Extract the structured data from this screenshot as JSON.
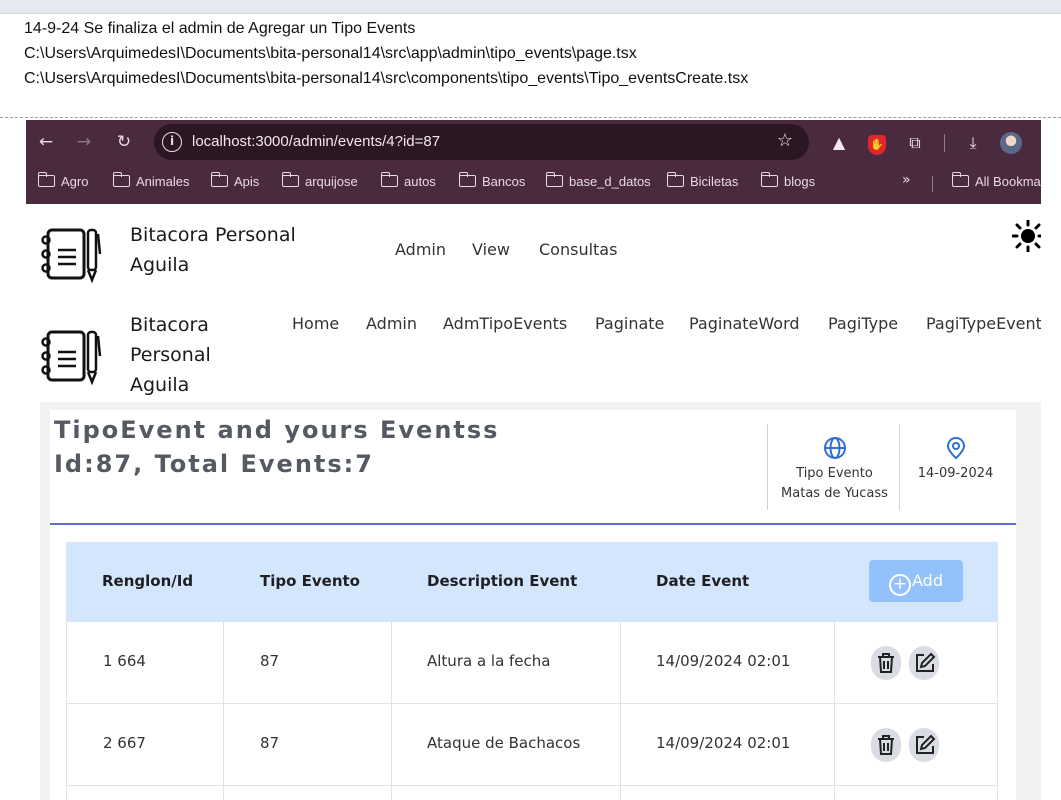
{
  "notes": {
    "line1": "14-9-24  Se finaliza el admin de Agregar un Tipo Events",
    "line2": "C:\\Users\\ArquimedesI\\Documents\\bita-personal14\\src\\app\\admin\\tipo_events\\page.tsx",
    "line3": "C:\\Users\\ArquimedesI\\Documents\\bita-personal14\\src\\components\\tipo_events\\Tipo_eventsCreate.tsx"
  },
  "browser": {
    "url": "localhost:3000/admin/events/4?id=87",
    "bookmarks": [
      "Agro",
      "Animales",
      "Apis",
      "arquijose",
      "autos",
      "Bancos",
      "base_d_datos",
      "Biciletas",
      "blogs"
    ],
    "bookmarks_more": "»",
    "all_bookmarks": "All Bookma"
  },
  "header1": {
    "brand_line1": "Bitacora Personal",
    "brand_line2": "Aguila",
    "nav": [
      "Admin",
      "View",
      "Consultas"
    ]
  },
  "header2": {
    "brand_line1": "Bitacora",
    "brand_line2": "Personal",
    "brand_line3": "Aguila",
    "nav": [
      "Home",
      "Admin",
      "AdmTipoEvents",
      "Paginate",
      "PaginateWord",
      "PagiType",
      "PagiTypeEvent"
    ]
  },
  "card": {
    "title1": "TipoEvent and yours Eventss",
    "title2": "Id:87, Total Events:7",
    "info1_line1": "Tipo Evento",
    "info1_line2": "Matas de Yucass",
    "info2_line1": "14-09-2024"
  },
  "table": {
    "headers": [
      "Renglon/Id",
      "Tipo Evento",
      "Description Event",
      "Date Event"
    ],
    "add_label": "Add",
    "rows": [
      {
        "id": "1 664",
        "tipo": "87",
        "description": "Altura a la fecha",
        "date": "14/09/2024 02:01"
      },
      {
        "id": "2 667",
        "tipo": "87",
        "description": "Ataque de Bachacos",
        "date": "14/09/2024 02:01"
      }
    ]
  },
  "colors": {
    "chrome": "#4a2a3e",
    "table_header": "#d4e6fb",
    "add_button": "#93c1fb",
    "accent_rule": "#5a72cf",
    "info_icon": "#2f6fd6"
  }
}
